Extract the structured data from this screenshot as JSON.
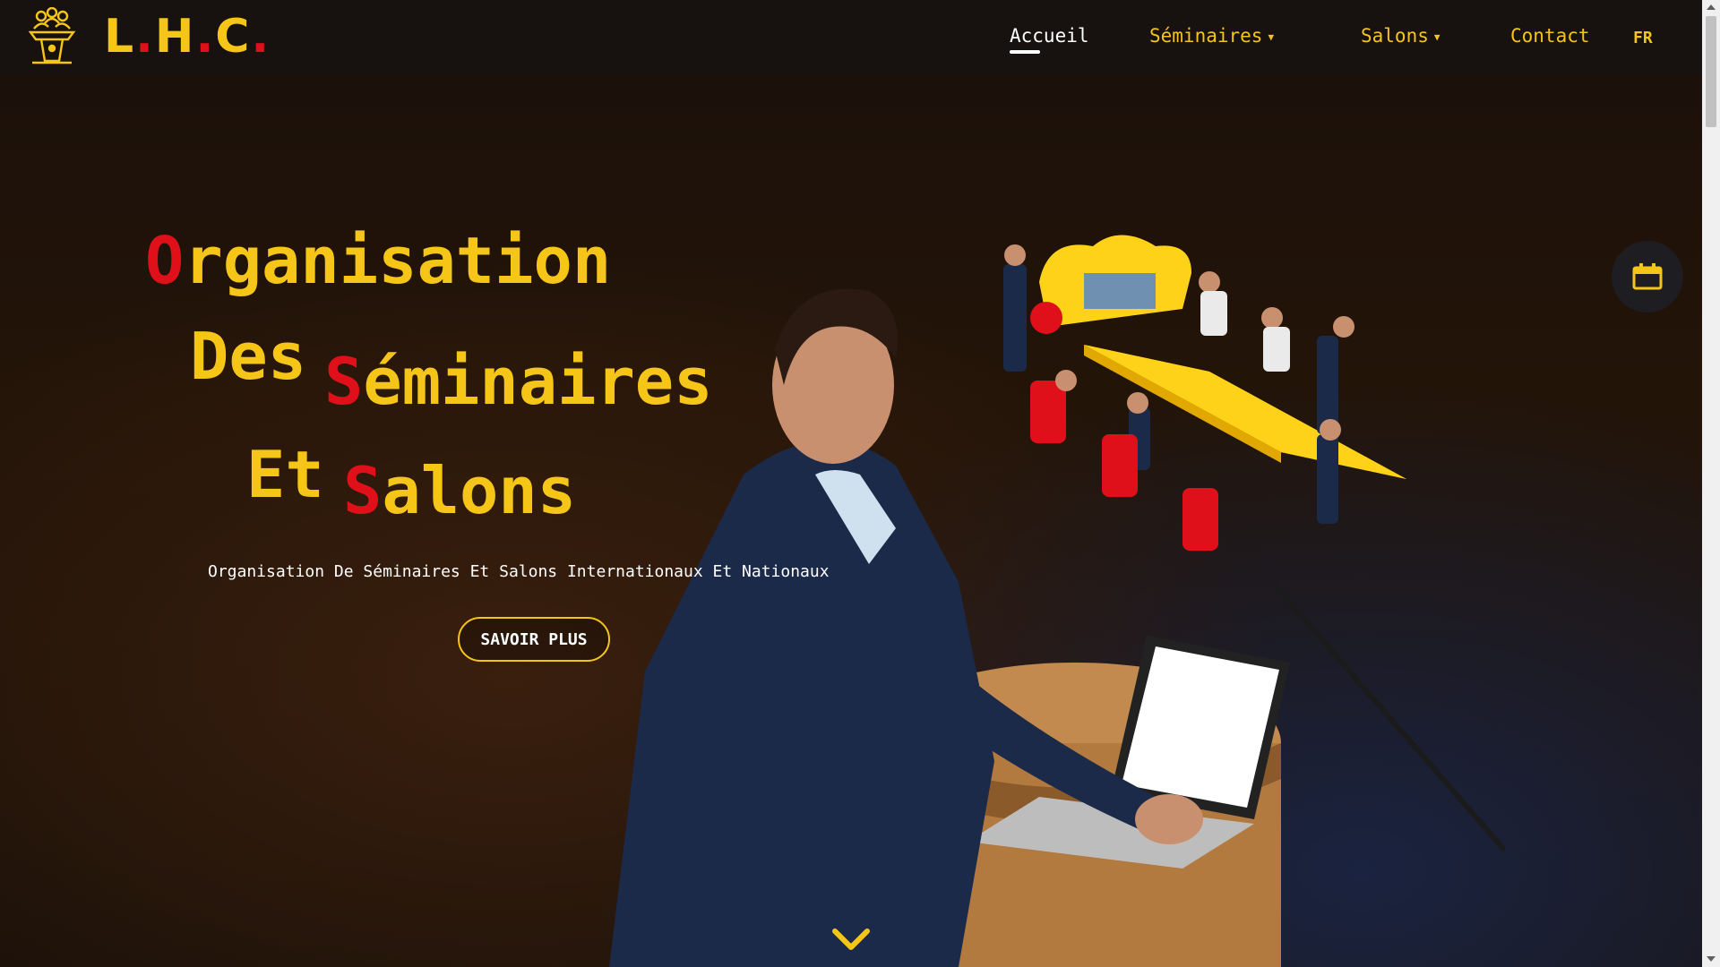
{
  "brand": {
    "name_part1": "L",
    "dot1": ".",
    "name_part2": "H",
    "dot2": ".",
    "name_part3": "C",
    "dot3": "."
  },
  "nav": {
    "home": "Accueil",
    "seminars": "Séminaires",
    "salons": "Salons",
    "contact": "Contact",
    "language": "FR"
  },
  "hero": {
    "line1_initial": "O",
    "line1_rest": "rganisation",
    "line2_word": "Des",
    "line2_initial": "S",
    "line2_rest": "éminaires",
    "line3_word": "Et",
    "line3_initial": "S",
    "line3_rest": "alons",
    "subtitle": "Organisation De Séminaires Et Salons Internationaux Et Nationaux",
    "cta_label": "SAVOIR PLUS"
  },
  "colors": {
    "accent": "#f5c518",
    "highlight": "#e0101a",
    "nav_bg": "#17120f",
    "text": "#ffffff"
  },
  "icons": [
    "podium-people-logo-icon",
    "chevron-down-icon",
    "calendar-icon",
    "caret-down-icon"
  ]
}
